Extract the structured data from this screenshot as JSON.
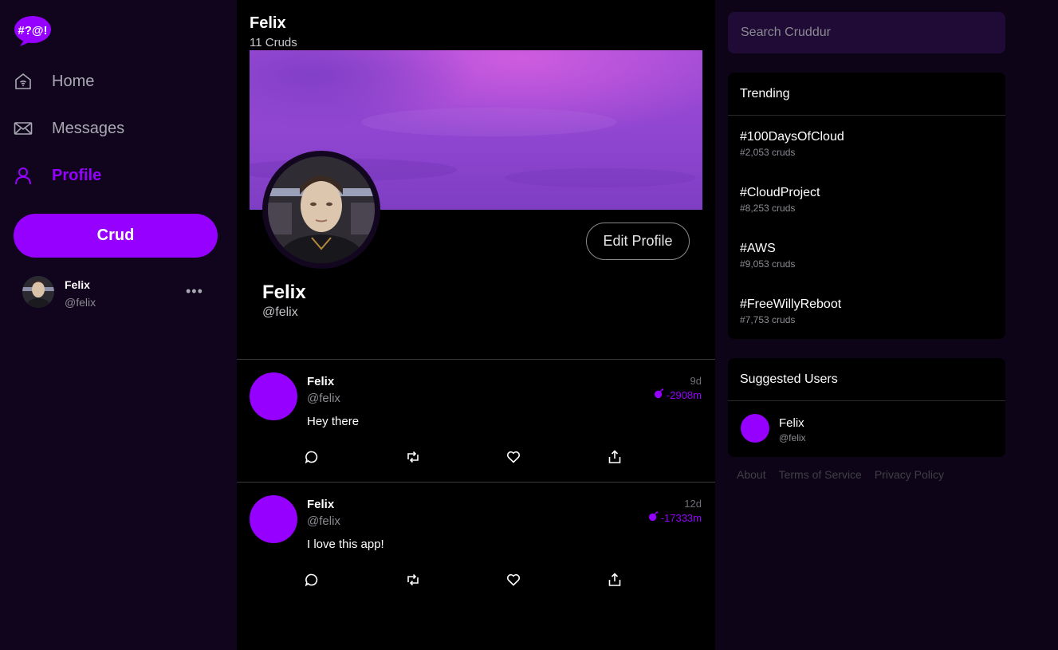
{
  "logo": {
    "text": "#?@!",
    "icon": "speech-bubble-logo"
  },
  "nav": {
    "items": [
      {
        "label": "Home",
        "icon": "home-wifi-icon"
      },
      {
        "label": "Messages",
        "icon": "envelope-icon"
      },
      {
        "label": "Profile",
        "icon": "user-icon",
        "active": true
      }
    ]
  },
  "crud_button": "Crud",
  "current_user": {
    "name": "Felix",
    "handle": "@felix",
    "more": "•••"
  },
  "header": {
    "name": "Felix",
    "count": "11 Cruds"
  },
  "profile": {
    "edit_label": "Edit Profile",
    "name": "Felix",
    "handle": "@felix"
  },
  "posts": [
    {
      "name": "Felix",
      "handle": "@felix",
      "text": "Hey there",
      "age": "9d",
      "expires": "-2908m"
    },
    {
      "name": "Felix",
      "handle": "@felix",
      "text": "I love this app!",
      "age": "12d",
      "expires": "-17333m"
    }
  ],
  "search": {
    "placeholder": "Search Cruddur"
  },
  "trending": {
    "title": "Trending",
    "items": [
      {
        "tag": "#100DaysOfCloud",
        "count": "#2,053 cruds"
      },
      {
        "tag": "#CloudProject",
        "count": "#8,253 cruds"
      },
      {
        "tag": "#AWS",
        "count": "#9,053 cruds"
      },
      {
        "tag": "#FreeWillyReboot",
        "count": "#7,753 cruds"
      }
    ]
  },
  "suggested": {
    "title": "Suggested Users",
    "users": [
      {
        "name": "Felix",
        "handle": "@felix"
      }
    ]
  },
  "footer": {
    "about": "About",
    "terms": "Terms of Service",
    "privacy": "Privacy Policy"
  },
  "colors": {
    "accent": "#9500ff",
    "sidebar_bg": "#10051c",
    "page_bg": "#0d0417",
    "search_bg": "#1f0b35"
  }
}
